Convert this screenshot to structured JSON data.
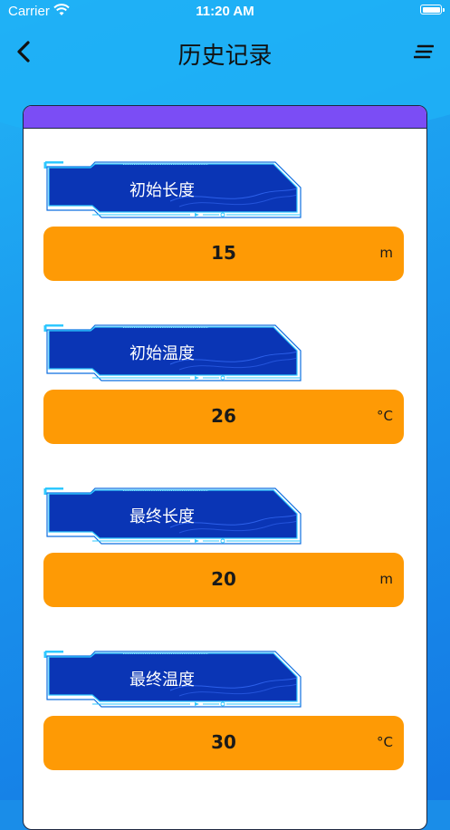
{
  "status_bar": {
    "carrier": "Carrier",
    "time": "11:20 AM"
  },
  "nav": {
    "title": "历史记录",
    "back_icon": "chevron-left-icon",
    "menu_icon": "list-icon"
  },
  "colors": {
    "accent_strip": "#7b4df5",
    "value_box": "#fe9a05",
    "label_plate": "#0a35b5"
  },
  "records": [
    {
      "label": "初始长度",
      "value": "15",
      "unit": "m"
    },
    {
      "label": "初始温度",
      "value": "26",
      "unit": "°C"
    },
    {
      "label": "最终长度",
      "value": "20",
      "unit": "m"
    },
    {
      "label": "最终温度",
      "value": "30",
      "unit": "°C"
    }
  ]
}
